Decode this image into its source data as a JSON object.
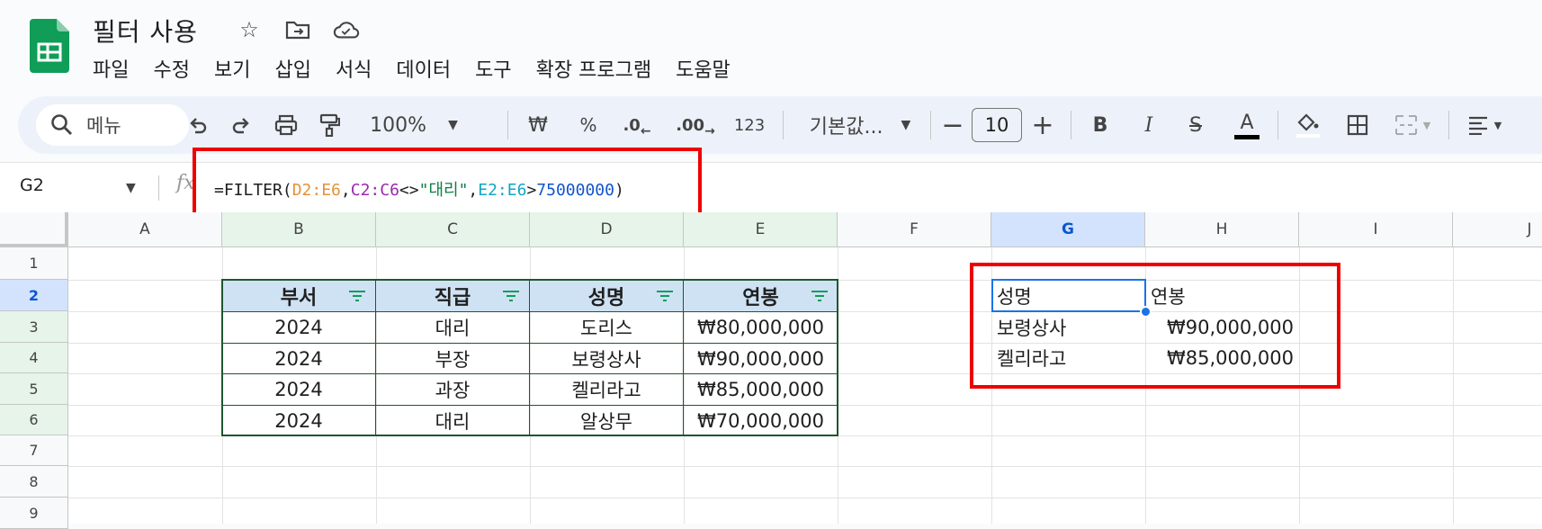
{
  "doc": {
    "title": "필터 사용"
  },
  "menu": [
    "파일",
    "수정",
    "보기",
    "삽입",
    "서식",
    "데이터",
    "도구",
    "확장 프로그램",
    "도움말"
  ],
  "toolbar": {
    "search_label": "메뉴",
    "zoom": "100%",
    "currency": "₩",
    "percent": "%",
    "dec_decrease": ".0",
    "dec_increase": ".00",
    "number_format": "123",
    "font": "기본값...",
    "font_size": "10",
    "bold": "B",
    "italic": "I",
    "strike": "S",
    "text_color": "A"
  },
  "formula_bar": {
    "cell_ref": "G2",
    "fx": "fx",
    "formula_parts": [
      "=FILTER(",
      "D2:E6",
      ",",
      "C2:C6",
      "<>",
      "\"대리\"",
      ",",
      "E2:E6",
      ">",
      "75000000",
      ")"
    ]
  },
  "columns": [
    "A",
    "B",
    "C",
    "D",
    "E",
    "F",
    "G",
    "H",
    "I",
    "J"
  ],
  "rows": [
    "1",
    "2",
    "3",
    "4",
    "5",
    "6",
    "7",
    "8",
    "9"
  ],
  "table": {
    "headers": [
      "부서",
      "직급",
      "성명",
      "연봉"
    ],
    "rows": [
      [
        "2024",
        "대리",
        "도리스",
        "₩80,000,000"
      ],
      [
        "2024",
        "부장",
        "보령상사",
        "₩90,000,000"
      ],
      [
        "2024",
        "과장",
        "켈리라고",
        "₩85,000,000"
      ],
      [
        "2024",
        "대리",
        "알상무",
        "₩70,000,000"
      ]
    ]
  },
  "result": {
    "headers": [
      "성명",
      "연봉"
    ],
    "rows": [
      [
        "보령상사",
        "₩90,000,000"
      ],
      [
        "켈리라고",
        "₩85,000,000"
      ]
    ]
  }
}
